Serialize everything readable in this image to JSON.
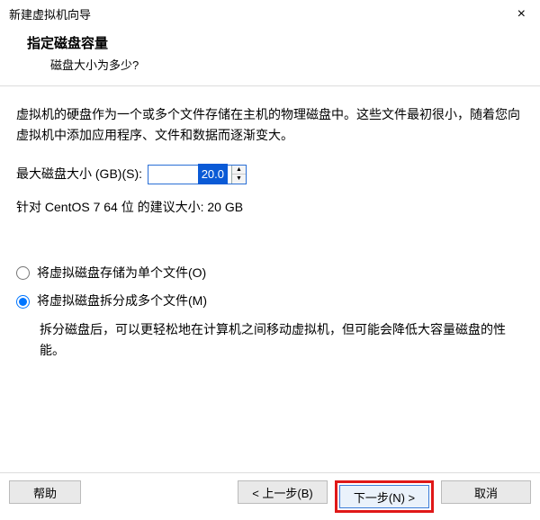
{
  "window": {
    "title": "新建虚拟机向导"
  },
  "header": {
    "heading": "指定磁盘容量",
    "subheading": "磁盘大小为多少?"
  },
  "intro_text": "虚拟机的硬盘作为一个或多个文件存储在主机的物理磁盘中。这些文件最初很小，随着您向虚拟机中添加应用程序、文件和数据而逐渐变大。",
  "disk_size": {
    "label": "最大磁盘大小 (GB)(S):",
    "value": "20.0"
  },
  "recommend": "针对 CentOS 7 64 位 的建议大小: 20 GB",
  "storage": {
    "single_label": "将虚拟磁盘存储为单个文件(O)",
    "split_label": "将虚拟磁盘拆分成多个文件(M)",
    "split_desc": "拆分磁盘后，可以更轻松地在计算机之间移动虚拟机，但可能会降低大容量磁盘的性能。",
    "selected": "split"
  },
  "buttons": {
    "help": "帮助",
    "back": "< 上一步(B)",
    "next": "下一步(N) >",
    "cancel": "取消"
  }
}
